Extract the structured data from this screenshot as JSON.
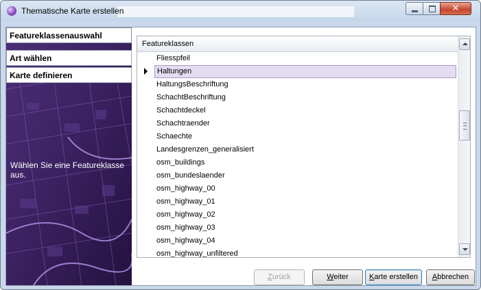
{
  "window": {
    "title": "Thematische Karte erstellen"
  },
  "wizard": {
    "steps": [
      {
        "label": "Featureklassenauswahl",
        "active": true
      },
      {
        "label": "Art wählen",
        "active": false
      },
      {
        "label": "Karte definieren",
        "active": false
      }
    ],
    "hint": "Wählen Sie eine Featureklasse aus."
  },
  "grid": {
    "header": "Featureklassen",
    "rows": [
      "Fliesspfeil",
      "Haltungen",
      "HaltungsBeschriftung",
      "SchachtBeschriftung",
      "Schachtdeckel",
      "Schachtraender",
      "Schaechte",
      "Landesgrenzen_generalisiert",
      "osm_buildings",
      "osm_bundeslaender",
      "osm_highway_00",
      "osm_highway_01",
      "osm_highway_02",
      "osm_highway_03",
      "osm_highway_04",
      "osm_highway_unfiltered"
    ],
    "selected_row": "Haltungen"
  },
  "buttons": {
    "back": {
      "mnemonic": "Z",
      "rest": "urück"
    },
    "next": {
      "mnemonic": "W",
      "rest": "eiter"
    },
    "create": {
      "mnemonic": "K",
      "rest": "arte erstellen"
    },
    "cancel": {
      "mnemonic": "A",
      "rest": "bbrechen"
    }
  },
  "colors": {
    "selection": "#e3ddf2",
    "wizard_bg": "#3b2360",
    "title_bar": "#c9d8ea"
  }
}
